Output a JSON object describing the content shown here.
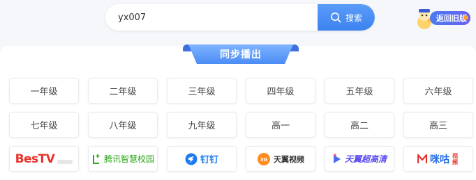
{
  "search": {
    "value": "yx007",
    "button_label": "搜索"
  },
  "old_version": {
    "label": "返回旧版"
  },
  "section": {
    "title": "同步播出"
  },
  "grades": [
    "一年级",
    "二年级",
    "三年级",
    "四年级",
    "五年级",
    "六年级",
    "七年级",
    "八年级",
    "九年级",
    "高一",
    "高二",
    "高三"
  ],
  "channels": {
    "bestv": "BesTV",
    "tencent": "腾讯智慧校园",
    "dingtalk": "钉钉",
    "tianyi_video": "天翼视频",
    "tianyi_hd": "天翼超高清",
    "migu": "咪咕",
    "migu_sub": "视频"
  },
  "colors": {
    "accent": "#4b8cf5",
    "bestv_red": "#e8322b",
    "tencent_green": "#2aa515",
    "dingtalk_blue": "#1e7cf2"
  }
}
